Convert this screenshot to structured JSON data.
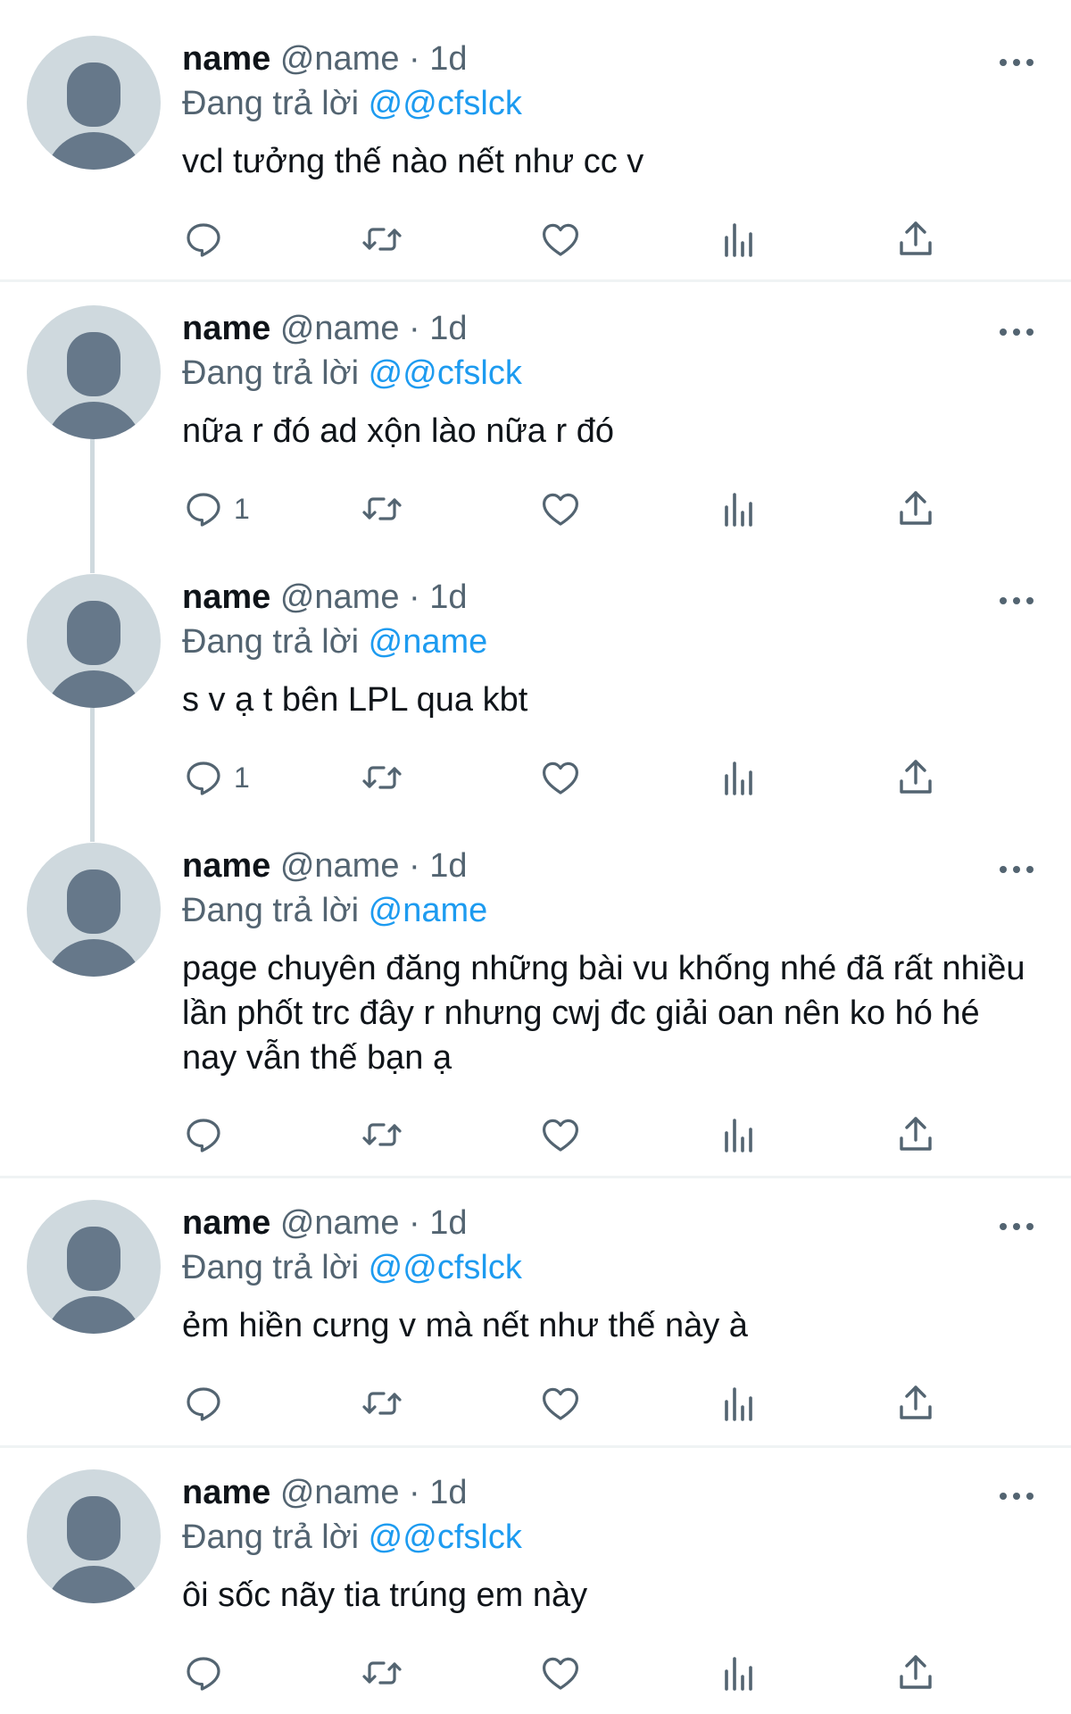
{
  "tweets": [
    {
      "name": "name",
      "handle": "@name",
      "time": "· 1d",
      "reply_prefix": "Đang trả lời",
      "reply_to": "@@cfslck",
      "text": "vcl tưởng thế nào nết như cc v",
      "reply_count": ""
    },
    {
      "name": "name",
      "handle": "@name",
      "time": "· 1d",
      "reply_prefix": "Đang trả lời",
      "reply_to": "@@cfslck",
      "text": "nữa r đó ad xộn lào nữa r đó",
      "reply_count": "1"
    },
    {
      "name": "name",
      "handle": "@name",
      "time": "· 1d",
      "reply_prefix": "Đang trả lời",
      "reply_to": "@name",
      "text": "s v ạ t bên LPL qua kbt",
      "reply_count": "1"
    },
    {
      "name": "name",
      "handle": "@name",
      "time": "· 1d",
      "reply_prefix": "Đang trả lời",
      "reply_to": "@name",
      "text": "page chuyên đăng những bài vu khống nhé đã rất nhiều lần phốt trc đây r nhưng cwj đc giải oan nên ko hó hé nay vẫn thế bạn ạ",
      "reply_count": ""
    },
    {
      "name": "name",
      "handle": "@name",
      "time": "· 1d",
      "reply_prefix": "Đang trả lời",
      "reply_to": "@@cfslck",
      "text": "ẻm hiền cưng v mà nết như thế này à",
      "reply_count": ""
    },
    {
      "name": "name",
      "handle": "@name",
      "time": "· 1d",
      "reply_prefix": "Đang trả lời",
      "reply_to": "@@cfslck",
      "text": "ôi sốc nãy tia trúng em này",
      "reply_count": ""
    }
  ],
  "icons": {
    "reply": "reply-icon",
    "retweet": "retweet-icon",
    "like": "heart-icon",
    "views": "views-icon",
    "share": "share-icon",
    "more": "more-icon",
    "avatar": "default-avatar"
  },
  "colors": {
    "accent": "#1d9bf0",
    "secondary_text": "#536471",
    "avatar_bg": "#cfd9de",
    "avatar_fg": "#66788a"
  }
}
